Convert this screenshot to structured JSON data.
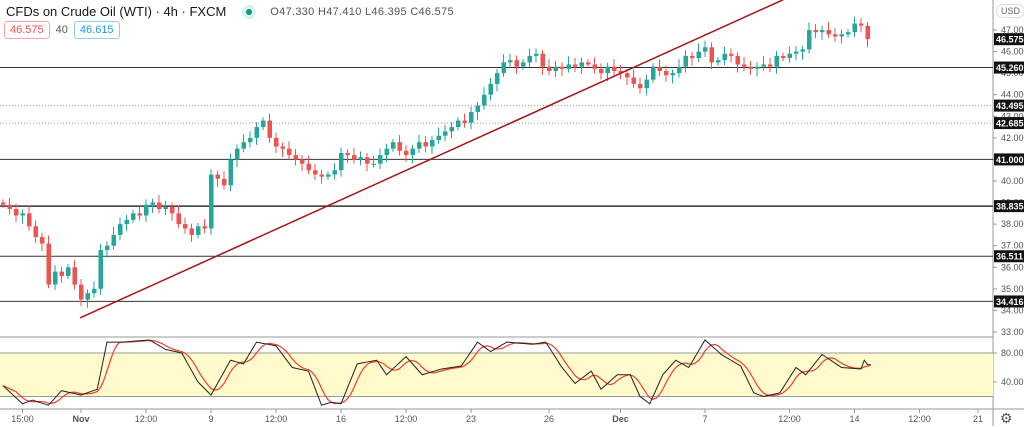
{
  "header": {
    "title": "CFDs on Crude Oil (WTI) · 4h · FXCM",
    "ohlc": "O47.330 H47.410 L46.395 C46.575",
    "sell_price": "46.575",
    "spread": "40",
    "buy_price": "46.615",
    "currency": "USD"
  },
  "chart_data": {
    "type": "candlestick",
    "title": "CFDs on Crude Oil (WTI) · 4h · FXCM",
    "ylim": [
      33.0,
      48.4
    ],
    "y_ticks": [
      "47.000",
      "46.000",
      "45.000",
      "44.000",
      "43.000",
      "42.000",
      "41.000",
      "40.000",
      "39.000",
      "38.000",
      "37.000",
      "36.000",
      "35.000",
      "34.000",
      "33.000"
    ],
    "x_ticks": [
      {
        "label": "15:00",
        "i": 3
      },
      {
        "label": "Nov",
        "i": 12
      },
      {
        "label": "12:00",
        "i": 22
      },
      {
        "label": "9",
        "i": 32
      },
      {
        "label": "12:00",
        "i": 42
      },
      {
        "label": "16",
        "i": 52
      },
      {
        "label": "12:00",
        "i": 62
      },
      {
        "label": "23",
        "i": 72
      },
      {
        "label": "26",
        "i": 84
      },
      {
        "label": "Dec",
        "i": 95
      },
      {
        "label": "7",
        "i": 108
      },
      {
        "label": "12:00",
        "i": 121
      },
      {
        "label": "14",
        "i": 131
      },
      {
        "label": "12:00",
        "i": 141
      },
      {
        "label": "21",
        "i": 150
      }
    ],
    "closes": [
      38.9,
      38.7,
      38.4,
      38.5,
      37.9,
      37.4,
      37.1,
      35.2,
      35.8,
      35.6,
      36.0,
      35.2,
      34.5,
      34.8,
      35.0,
      36.8,
      37.0,
      37.5,
      38.0,
      38.2,
      38.5,
      38.4,
      38.9,
      39.0,
      38.7,
      38.8,
      38.5,
      38.0,
      37.8,
      37.5,
      37.9,
      37.8,
      40.3,
      40.1,
      39.8,
      41.0,
      41.5,
      41.8,
      42.0,
      42.5,
      42.8,
      42.0,
      41.6,
      41.5,
      41.2,
      41.0,
      40.8,
      40.5,
      40.3,
      40.2,
      40.3,
      40.5,
      41.3,
      41.2,
      41.0,
      41.1,
      40.8,
      40.8,
      41.2,
      41.5,
      41.8,
      41.4,
      41.2,
      41.5,
      41.8,
      41.6,
      41.9,
      42.1,
      42.3,
      42.5,
      42.8,
      42.7,
      43.2,
      43.5,
      44.0,
      44.5,
      45.0,
      45.5,
      45.6,
      45.3,
      45.5,
      45.8,
      45.9,
      45.3,
      45.1,
      45.3,
      45.2,
      45.4,
      45.3,
      45.5,
      45.4,
      45.2,
      45.0,
      45.3,
      45.1,
      45.0,
      44.8,
      44.5,
      44.3,
      44.7,
      45.3,
      45.1,
      44.9,
      45.0,
      45.3,
      45.8,
      45.7,
      46.0,
      46.2,
      45.5,
      45.6,
      45.9,
      45.8,
      45.4,
      45.3,
      45.2,
      45.3,
      45.4,
      45.3,
      45.8,
      45.7,
      45.9,
      46.0,
      46.1,
      47.0,
      46.9,
      47.0,
      46.8,
      46.7,
      46.8,
      46.9,
      47.3,
      47.2,
      46.575
    ],
    "horizontal_levels": [
      {
        "price": 45.26,
        "label": "45.260",
        "style": "solid"
      },
      {
        "price": 43.495,
        "label": "43.495",
        "style": "dotted"
      },
      {
        "price": 42.685,
        "label": "42.685",
        "style": "dotted"
      },
      {
        "price": 41.0,
        "label": "41.000",
        "style": "solid"
      },
      {
        "price": 38.835,
        "label": "38.835",
        "style": "solid"
      },
      {
        "price": 36.511,
        "label": "36.511",
        "style": "solid"
      },
      {
        "price": 34.416,
        "label": "34.416",
        "style": "solid"
      }
    ],
    "last_price": {
      "price": 46.575,
      "label": "46.575"
    },
    "trendline": {
      "from": {
        "i": 12,
        "price": 33.65
      },
      "to": {
        "i": 120,
        "price": 48.4
      }
    },
    "stochastic": {
      "ylim": [
        0,
        100
      ],
      "band": [
        20,
        80
      ],
      "y_ticks": [
        "80.00",
        "40.00"
      ],
      "k_points": [
        [
          0,
          35
        ],
        [
          3,
          10
        ],
        [
          4.5,
          15
        ],
        [
          7,
          8
        ],
        [
          9,
          28
        ],
        [
          12,
          22
        ],
        [
          14.5,
          30
        ],
        [
          16,
          95
        ],
        [
          18.5,
          95
        ],
        [
          22.5,
          98
        ],
        [
          25,
          85
        ],
        [
          27.5,
          80
        ],
        [
          30,
          40
        ],
        [
          32,
          22
        ],
        [
          35,
          70
        ],
        [
          37,
          65
        ],
        [
          39,
          95
        ],
        [
          42,
          90
        ],
        [
          44.5,
          60
        ],
        [
          47,
          55
        ],
        [
          49,
          8
        ],
        [
          50.5,
          12
        ],
        [
          52,
          10
        ],
        [
          54.5,
          65
        ],
        [
          57.5,
          70
        ],
        [
          59,
          50
        ],
        [
          62,
          75
        ],
        [
          64.5,
          50
        ],
        [
          67.5,
          58
        ],
        [
          70.5,
          62
        ],
        [
          73,
          95
        ],
        [
          75,
          82
        ],
        [
          77.5,
          95
        ],
        [
          81.5,
          92
        ],
        [
          83.5,
          95
        ],
        [
          86,
          60
        ],
        [
          88,
          38
        ],
        [
          90.5,
          55
        ],
        [
          92,
          30
        ],
        [
          94.5,
          50
        ],
        [
          96.5,
          50
        ],
        [
          98,
          20
        ],
        [
          99.5,
          10
        ],
        [
          101.5,
          50
        ],
        [
          103.5,
          70
        ],
        [
          105.5,
          60
        ],
        [
          108,
          98
        ],
        [
          110.5,
          78
        ],
        [
          113.5,
          62
        ],
        [
          115.5,
          25
        ],
        [
          117,
          20
        ],
        [
          119.5,
          25
        ],
        [
          122,
          60
        ],
        [
          123.5,
          50
        ],
        [
          126,
          78
        ],
        [
          129,
          60
        ],
        [
          132,
          58
        ],
        [
          132.5,
          70
        ],
        [
          133,
          64
        ]
      ]
    },
    "colors": {
      "up": "#26a69a",
      "down": "#ef5350",
      "trend": "#a31515",
      "k": "#222222",
      "d": "#f23c2c",
      "band": "#fffbcc"
    }
  }
}
